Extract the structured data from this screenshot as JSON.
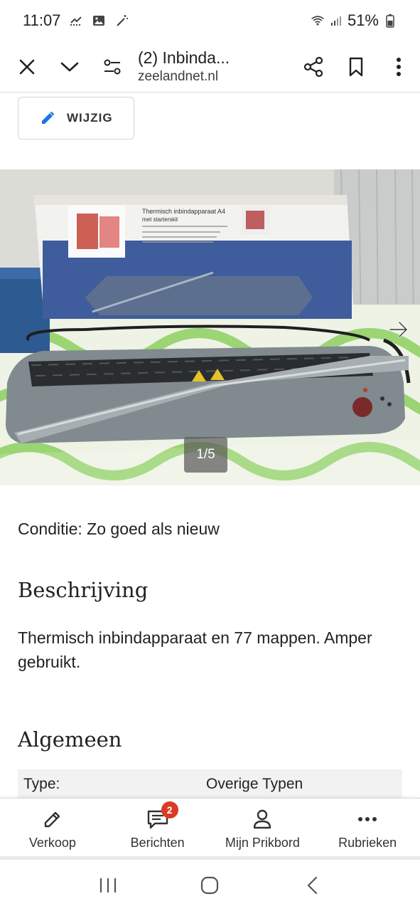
{
  "status_bar": {
    "time": "11:07",
    "battery": "51%",
    "icons": [
      "missed-call-icon",
      "gallery-icon",
      "wand-icon",
      "wifi-icon",
      "signal-icon",
      "battery-icon"
    ]
  },
  "browser": {
    "title": "(2) Inbinda...",
    "domain": "zeelandnet.nl",
    "icons": [
      "close-icon",
      "chevron-down-icon",
      "tune-icon",
      "share-icon",
      "bookmark-icon",
      "more-vert-icon"
    ]
  },
  "edit_button": {
    "label": "WIJZIG",
    "icon": "pencil-icon"
  },
  "gallery": {
    "counter": "1/5",
    "next_icon": "arrow-right-icon"
  },
  "listing": {
    "condition": "Conditie: Zo goed als nieuw",
    "description_heading": "Beschrijving",
    "description_text": "Thermisch inbindapparaat en 77 mappen. Amper gebruikt.",
    "general_heading": "Algemeen",
    "specs": [
      {
        "key": "Type:",
        "value": "Overige Typen"
      }
    ]
  },
  "product_box": {
    "title": "Thermisch inbindapparaat A4",
    "subtitle": "met starterskit"
  },
  "bottom_nav": {
    "items": [
      {
        "label": "Verkoop",
        "icon": "pencil-icon"
      },
      {
        "label": "Berichten",
        "icon": "chat-icon",
        "badge": "2"
      },
      {
        "label": "Mijn Prikbord",
        "icon": "person-icon"
      },
      {
        "label": "Rubrieken",
        "icon": "more-horiz-icon"
      }
    ]
  },
  "colors": {
    "badge": "#d93b26",
    "accent_blue": "#1a73e8",
    "divider": "#dadce0"
  }
}
